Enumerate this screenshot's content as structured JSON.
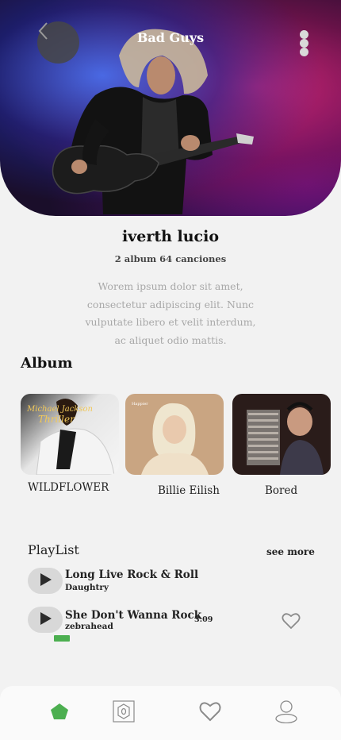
{
  "header": {
    "title": "Bad Guys",
    "back_icon": "chevron-left-icon",
    "menu_icon": "vertical-dots-icon"
  },
  "artist": {
    "name": "iverth lucio",
    "stats": "2 album 64 canciones",
    "bio": "Worem ipsum dolor sit amet, consectetur adipiscing elit. Nunc vulputate libero et velit interdum, ac aliquet odio mattis."
  },
  "albums": {
    "title": "Album",
    "items": [
      {
        "label": "WILDFLOWER",
        "cover_text": "Michael Jackson Thriller"
      },
      {
        "label": "Billie Eilish",
        "cover_text": "Happier Than Ever"
      },
      {
        "label": "Bored",
        "cover_text": ""
      }
    ]
  },
  "playlist": {
    "title": "PlayList",
    "see_more": "see more",
    "tracks": [
      {
        "title": "Long Live Rock & Roll",
        "artist": "Daughtry",
        "duration": ""
      },
      {
        "title": "She Don't Wanna Rock",
        "artist": "zebrahead",
        "duration": "3:09"
      }
    ]
  },
  "nav": {
    "items": [
      "home-icon",
      "library-icon",
      "heart-icon",
      "profile-icon"
    ],
    "active_color": "#4caf50"
  },
  "colors": {
    "background": "#f2f2f2",
    "accent": "#4caf50"
  }
}
